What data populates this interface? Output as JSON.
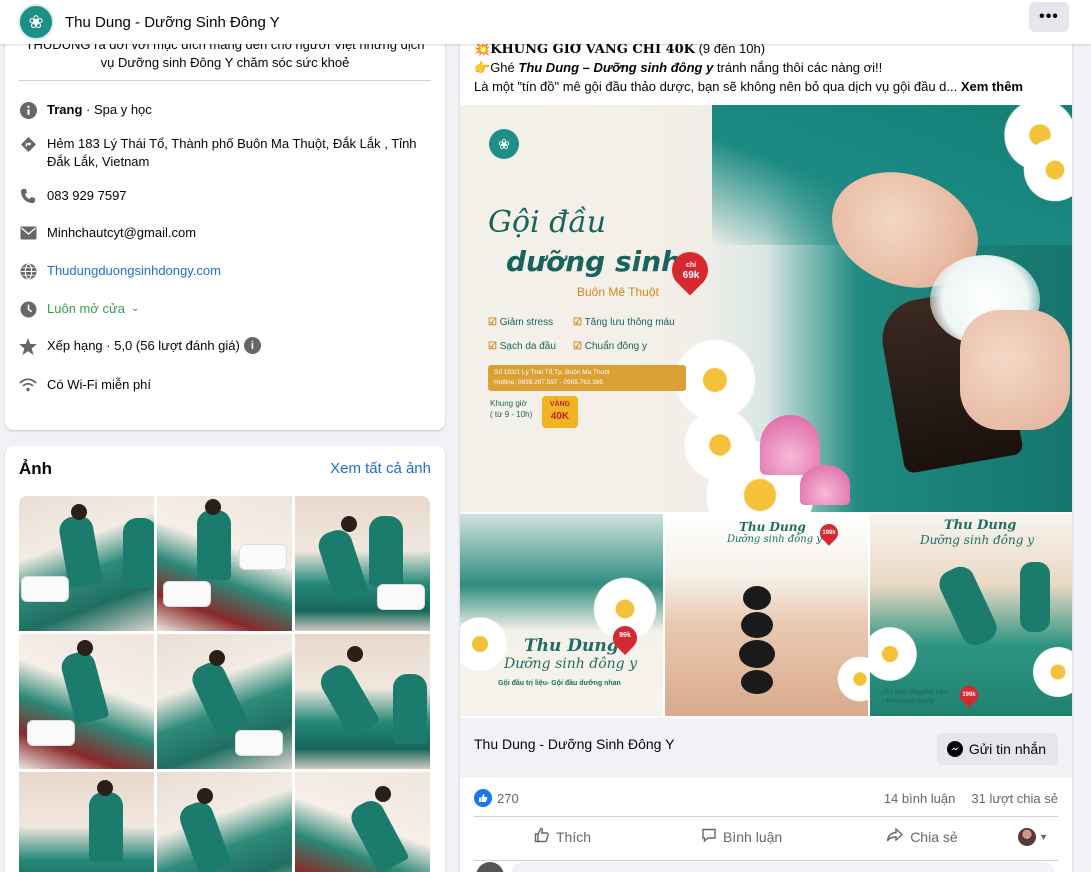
{
  "header": {
    "title": "Thu Dung - Dưỡng Sinh Đông Y",
    "more_label": "•••"
  },
  "intro": {
    "description_line1": "THUDUNG ra đời với mục đích mang đến cho người Việt những dịch",
    "description_line2": "vụ Dưỡng sinh Đông Y chăm sóc sức khoẻ",
    "page_type_label": "Trang",
    "page_type_value": " · Spa y học",
    "address": "Hẻm 183 Lý Thái Tổ, Thành phố Buôn Ma Thuột, Đắk Lắk , Tỉnh Đắk Lắk, Vietnam",
    "phone": "083 929 7597",
    "email": "Minhchautcyt@gmail.com",
    "website": "Thudungduongsinhdongy.com",
    "hours": "Luôn mở cửa",
    "rating": "Xếp hạng · 5,0 (56 lượt đánh giá)",
    "wifi": "Có Wi-Fi miễn phí",
    "icons": [
      "info-icon",
      "directions-icon",
      "phone-icon",
      "mail-icon",
      "globe-icon",
      "clock-icon",
      "star-icon",
      "wifi-icon"
    ]
  },
  "photos": {
    "title": "Ảnh",
    "see_all": "Xem tất cả ảnh"
  },
  "post": {
    "line1_emoji": "💥",
    "line1_bold": "KHUNG GIỜ VÀNG CHỈ 40K",
    "line1_rest": " (9 đến 10h)",
    "line2_emoji": "👉",
    "line2_pre": "Ghé ",
    "line2_bold": "Thu Dung – Dưỡng sinh đông y",
    "line2_rest": " tránh nắng thôi các nàng ơi!!",
    "line3": "Là một \"tín đồ\" mê gội đầu thảo dược, bạn sẽ không nên bỏ qua dịch vụ gội đầu d...",
    "see_more": "Xem thêm",
    "image": {
      "headline1": "Gội đầu",
      "headline2": "dưỡng sinh",
      "location": "Buôn Mê Thuột",
      "price_small": "chỉ",
      "price": "69k",
      "benefits": [
        "Giảm stress",
        "Tăng lưu thông máu",
        "Sạch da đầu",
        "Chuẩn đông y"
      ],
      "address_line": "Số 183/1 Lý Thái Tổ,Tp. Buôn Ma Thuột",
      "hotline": "Hotline: 0839.297.597 - 0965.763.395",
      "hours_line1": "Khung giờ",
      "hours_line2": "( từ 9 - 10h)",
      "gold_label": "VÀNG",
      "gold_price": "40K"
    },
    "thumbs": [
      {
        "brand": "Thu Dung",
        "sub": "Dưỡng sinh đông y",
        "price": "99k",
        "caption": "Gội đầu trị liệu- Gội đầu dưỡng nhan"
      },
      {
        "brand": "Thu Dung",
        "sub": "Dưỡng sinh đông y",
        "price": "199k"
      },
      {
        "brand": "Thu Dung",
        "sub": "Dưỡng sinh đông y",
        "price": "199k",
        "caption1": "-Trị liệu chuyên sâu",
        "caption2": "- Massage body"
      }
    ],
    "page_name": "Thu Dung - Dưỡng Sinh Đông Y",
    "message_button": "Gửi tin nhắn",
    "likes": "270",
    "comments": "14 bình luận",
    "shares": "31 lượt chia sẻ",
    "actions": {
      "like": "Thích",
      "comment": "Bình luận",
      "share": "Chia sẻ"
    }
  }
}
